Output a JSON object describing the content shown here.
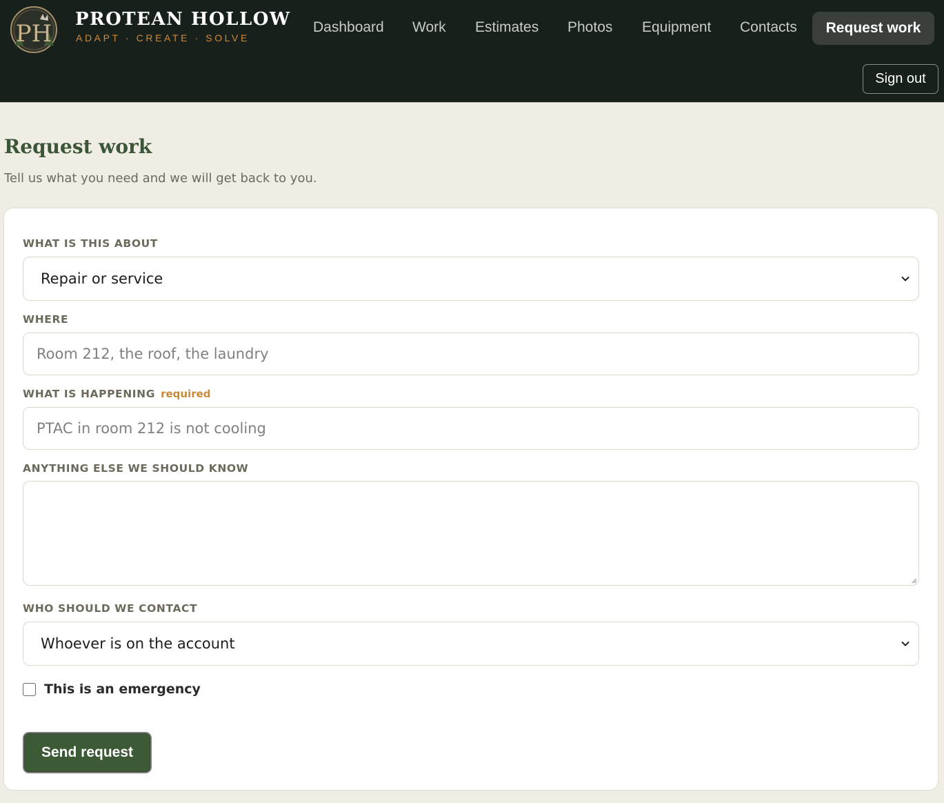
{
  "brand": {
    "monogram": "PH",
    "name": "PROTEAN HOLLOW",
    "tagline": "ADAPT · CREATE · SOLVE",
    "accent": "#d08a3a"
  },
  "nav": {
    "items": [
      {
        "label": "Dashboard"
      },
      {
        "label": "Work"
      },
      {
        "label": "Estimates"
      },
      {
        "label": "Photos"
      },
      {
        "label": "Equipment"
      },
      {
        "label": "Contacts"
      }
    ],
    "active": {
      "label": "Request work"
    },
    "signout_label": "Sign out"
  },
  "page": {
    "title": "Request work",
    "subtitle": "Tell us what you need and we will get back to you."
  },
  "form": {
    "about": {
      "label": "WHAT IS THIS ABOUT",
      "value": "Repair or service"
    },
    "where": {
      "label": "WHERE",
      "placeholder": "Room 212, the roof, the laundry"
    },
    "happening": {
      "label": "WHAT IS HAPPENING",
      "required_label": "required",
      "placeholder": "PTAC in room 212 is not cooling"
    },
    "notes": {
      "label": "ANYTHING ELSE WE SHOULD KNOW",
      "value": ""
    },
    "contact": {
      "label": "WHO SHOULD WE CONTACT",
      "value": "Whoever is on the account"
    },
    "emergency": {
      "label": "This is an emergency",
      "checked": false
    },
    "submit_label": "Send request"
  },
  "colors": {
    "header_bg": "#18201b",
    "page_bg": "#f0ede4",
    "title_green": "#3b5637",
    "button_green": "#3d5a37"
  }
}
